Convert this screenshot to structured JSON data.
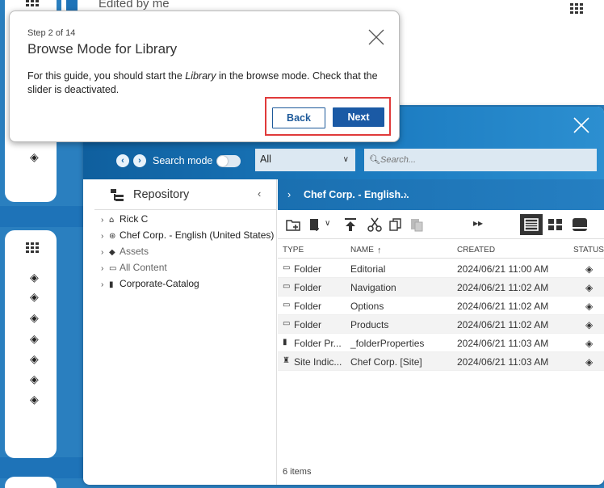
{
  "background": {
    "top_text": "Edited by me"
  },
  "guide": {
    "step": "Step 2 of 14",
    "title": "Browse Mode for Library",
    "body_before": "For this guide, you should start the ",
    "body_em": "Library",
    "body_after": " in the browse mode. Check that the slider is deactivated.",
    "back_label": "Back",
    "next_label": "Next"
  },
  "library": {
    "search_mode_label": "Search mode",
    "select_value": "All",
    "search_placeholder": "Search...",
    "tree": {
      "title": "Repository",
      "items": [
        {
          "label": "Rick C",
          "icon": "home-icon"
        },
        {
          "label": "Chef Corp. - English (United States)",
          "icon": "site-icon"
        },
        {
          "label": "Assets",
          "icon": "assets-icon"
        },
        {
          "label": "All Content",
          "icon": "folder-icon"
        },
        {
          "label": "Corporate-Catalog",
          "icon": "catalog-icon"
        }
      ]
    },
    "breadcrumb": "Chef Corp. - English...",
    "columns": {
      "type": "TYPE",
      "name": "NAME",
      "created": "CREATED",
      "status": "STATUS"
    },
    "rows": [
      {
        "type": "Folder",
        "name": "Editorial",
        "created": "2024/06/21 11:00 AM",
        "icon": "folder-icon"
      },
      {
        "type": "Folder",
        "name": "Navigation",
        "created": "2024/06/21 11:02 AM",
        "icon": "folder-icon"
      },
      {
        "type": "Folder",
        "name": "Options",
        "created": "2024/06/21 11:02 AM",
        "icon": "folder-icon"
      },
      {
        "type": "Folder",
        "name": "Products",
        "created": "2024/06/21 11:02 AM",
        "icon": "folder-icon"
      },
      {
        "type": "Folder Pr...",
        "name": "_folderProperties",
        "created": "2024/06/21 11:03 AM",
        "icon": "properties-icon"
      },
      {
        "type": "Site Indic...",
        "name": "Chef Corp. [Site]",
        "created": "2024/06/21 11:03 AM",
        "icon": "site-indicator-icon"
      }
    ],
    "item_count": "6 items"
  }
}
